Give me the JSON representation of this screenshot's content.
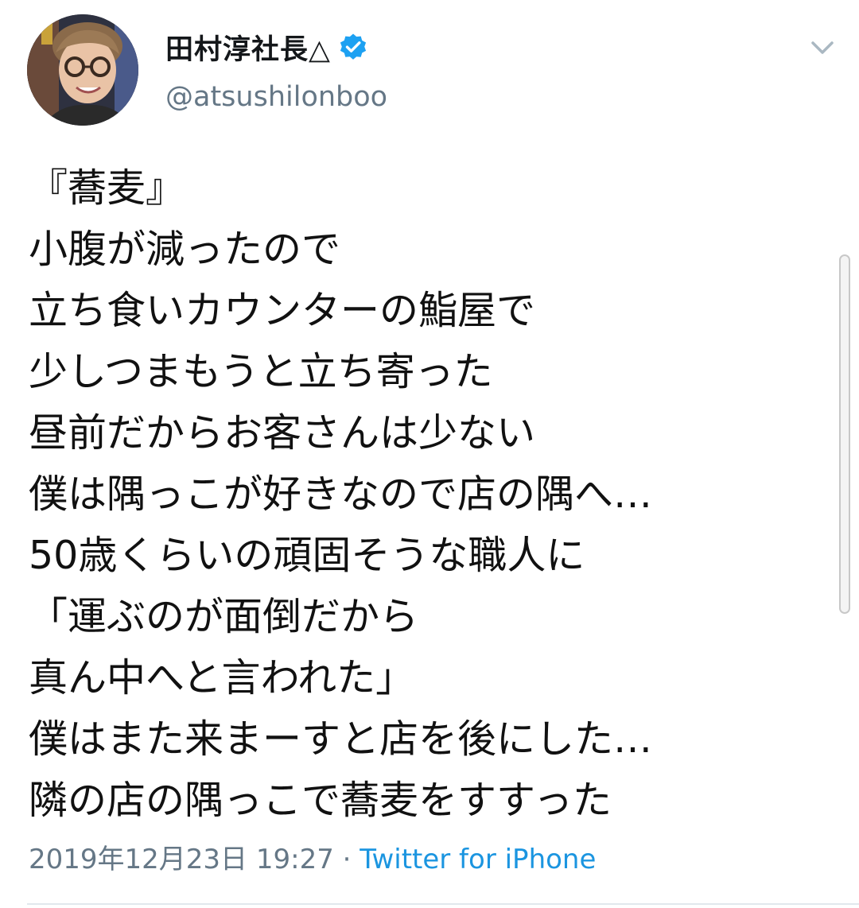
{
  "tweet": {
    "author": {
      "display_name": "田村淳社長△",
      "handle": "@atsushilonboo",
      "verified": true
    },
    "lines": [
      "『蕎麦』",
      "小腹が減ったので",
      "立ち食いカウンターの鮨屋で",
      "少しつまもうと立ち寄った",
      "昼前だからお客さんは少ない",
      "僕は隅っこが好きなので店の隅へ…",
      "50歳くらいの頑固そうな職人に",
      "「運ぶのが面倒だから",
      "真ん中へと言われた」",
      "僕はまた来まーすと店を後にした…",
      "隣の店の隅っこで蕎麦をすすった"
    ],
    "timestamp": "2019年12月23日 19:27",
    "separator": " · ",
    "source": "Twitter for iPhone"
  },
  "icons": {
    "verified": "verified-badge-icon",
    "menu": "chevron-down-icon"
  },
  "colors": {
    "accent": "#1b95e0",
    "verified_badge": "#1da1f2",
    "secondary_text": "#657786",
    "primary_text": "#14171a"
  }
}
